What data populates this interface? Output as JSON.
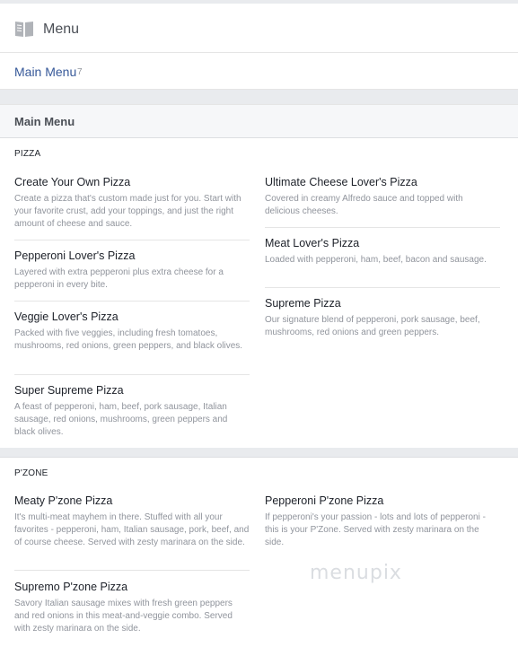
{
  "header": {
    "title": "Menu",
    "icon": "book-icon"
  },
  "tabs": {
    "label": "Main Menu",
    "count": "7"
  },
  "section": {
    "title": "Main Menu"
  },
  "categories": [
    {
      "name": "PIZZA",
      "left": [
        {
          "name": "Create Your Own Pizza",
          "desc": "Create a pizza that's custom made just for you. Start with your favorite crust, add your toppings, and just the right amount of cheese and sauce."
        },
        {
          "name": "Pepperoni Lover's Pizza",
          "desc": "Layered with extra pepperoni plus extra cheese for a pepperoni in every bite."
        },
        {
          "name": "Veggie Lover's Pizza",
          "desc": "Packed with five veggies, including fresh tomatoes, mushrooms, red onions, green peppers, and black olives."
        },
        {
          "name": "Super Supreme Pizza",
          "desc": "A feast of pepperoni, ham, beef, pork sausage, Italian sausage, red onions, mushrooms, green peppers and black olives."
        }
      ],
      "right": [
        {
          "name": "Ultimate Cheese Lover's Pizza",
          "desc": "Covered in creamy Alfredo sauce and topped with delicious cheeses."
        },
        {
          "name": "Meat Lover's Pizza",
          "desc": "Loaded with pepperoni, ham, beef, bacon and sausage."
        },
        {
          "name": "Supreme Pizza",
          "desc": "Our signature blend of pepperoni, pork sausage, beef, mushrooms, red onions and green peppers."
        }
      ]
    },
    {
      "name": "P'ZONE",
      "left": [
        {
          "name": "Meaty P'zone Pizza",
          "desc": "It's multi-meat mayhem in there. Stuffed with all your favorites - pepperoni, ham, Italian sausage, pork, beef, and of course cheese. Served with zesty marinara on the side."
        },
        {
          "name": "Supremo P'zone Pizza",
          "desc": "Savory Italian sausage mixes with fresh green peppers and red onions in this meat-and-veggie combo. Served with zesty marinara on the side."
        }
      ],
      "right": [
        {
          "name": "Pepperoni P'zone Pizza",
          "desc": "If pepperoni's your passion - lots and lots of pepperoni - this is your P'Zone. Served with zesty marinara on the side."
        }
      ]
    }
  ],
  "watermark": "menupix"
}
